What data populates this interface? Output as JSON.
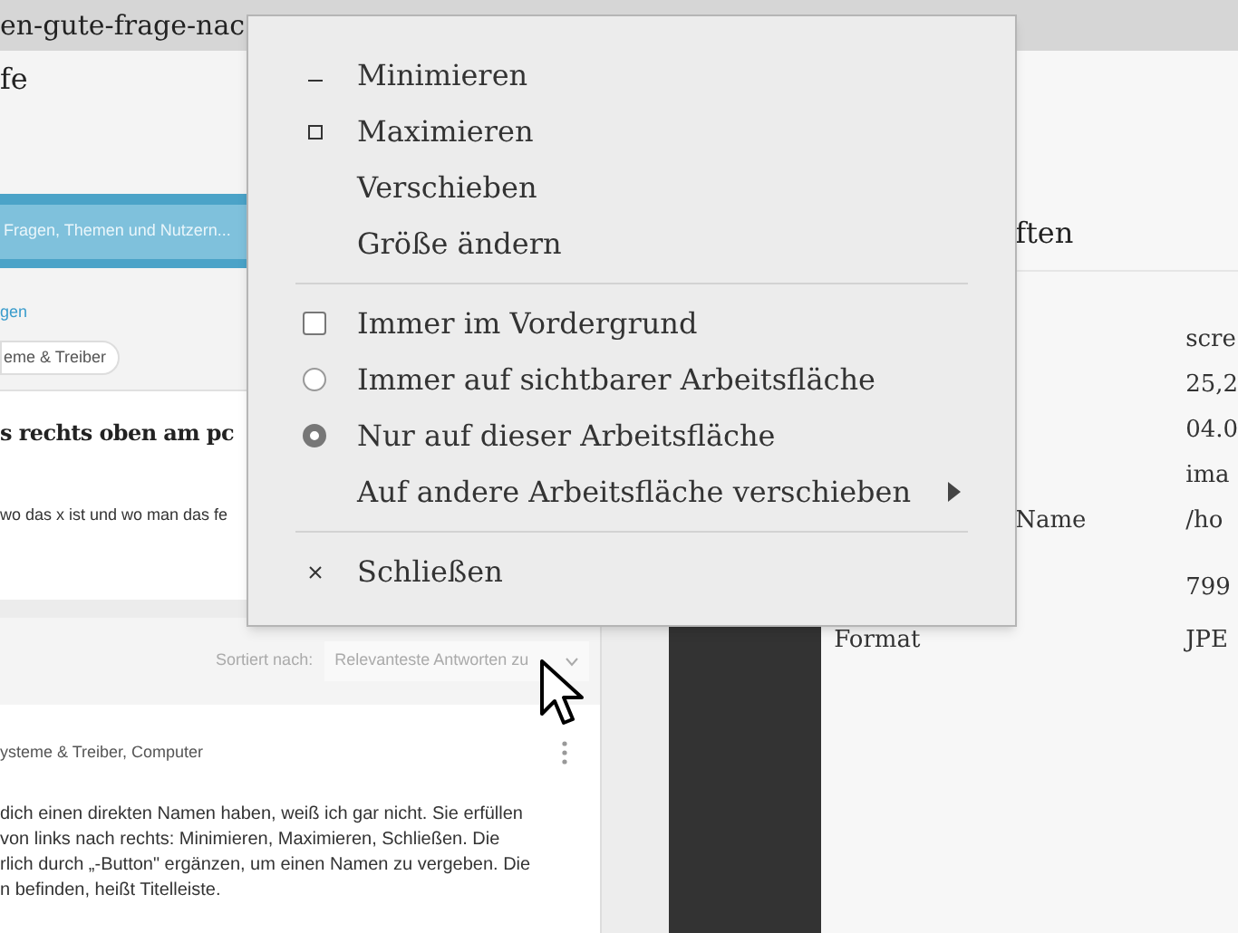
{
  "viewer": {
    "title": "en-gute-frage-nac",
    "heading": "fe"
  },
  "webpage": {
    "search_placeholder": "Fragen, Themen und Nutzern...",
    "link": "gen",
    "tag": "eme & Treiber",
    "question_title": "s rechts oben am pc",
    "question_text": "wo das x ist und wo man das fe",
    "sort_label": "Sortiert nach:",
    "sort_value": "Relevanteste Antworten zu",
    "answer_topics": "ysteme & Treiber, Computer",
    "answer_lines": [
      "dich einen direkten Namen haben, weiß ich gar nicht. Sie erfüllen",
      "von links nach rechts: Minimieren, Maximieren, Schließen. Die",
      "rlich durch „-Button\" ergänzen, um einen Namen zu vergeben. Die",
      "n befinden, heißt Titelleiste."
    ]
  },
  "properties": {
    "heading": "ften",
    "rows": [
      {
        "value": "scre"
      },
      {
        "value": "25,2"
      },
      {
        "value": "04.0"
      },
      {
        "value": "ima"
      },
      {
        "label": "Name",
        "value": "/ho"
      },
      {
        "value": "799"
      },
      {
        "label": "Format",
        "value": "JPE"
      }
    ]
  },
  "menu": {
    "sections": [
      [
        {
          "kind": "minimize",
          "label": "Minimieren"
        },
        {
          "kind": "maximize",
          "label": "Maximieren"
        },
        {
          "kind": "plain",
          "label": "Verschieben"
        },
        {
          "kind": "plain",
          "label": "Größe ändern"
        }
      ],
      [
        {
          "kind": "check",
          "label": "Immer im Vordergrund",
          "checked": false
        },
        {
          "kind": "radio",
          "label": "Immer auf sichtbarer Arbeitsfläche",
          "selected": false
        },
        {
          "kind": "radio",
          "label": "Nur auf dieser Arbeitsfläche",
          "selected": true
        },
        {
          "kind": "submenu",
          "label": "Auf andere Arbeitsfläche verschieben"
        }
      ],
      [
        {
          "kind": "close",
          "label": "Schließen"
        }
      ]
    ]
  }
}
